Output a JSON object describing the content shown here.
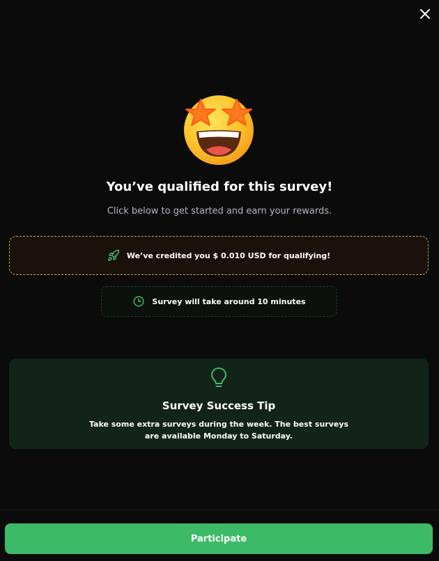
{
  "modal": {
    "close_icon": "close-icon",
    "emoji_icon": "star-struck-emoji-icon",
    "title": "You’ve qualified for this survey!",
    "subtitle": "Click below to get started and earn your rewards."
  },
  "credit": {
    "icon": "rocket-icon",
    "text": "We’ve credited you $ 0.010 USD for qualifying!",
    "border_color": "#d1a253"
  },
  "duration": {
    "icon": "clock-icon",
    "text": "Survey will take around 10 minutes"
  },
  "tip": {
    "icon": "lightbulb-icon",
    "title": "Survey Success Tip",
    "body": "Take some extra surveys during the week. The best surveys are available Monday to Saturday."
  },
  "actions": {
    "participate_label": "Participate",
    "accent_color": "#3dba67"
  }
}
